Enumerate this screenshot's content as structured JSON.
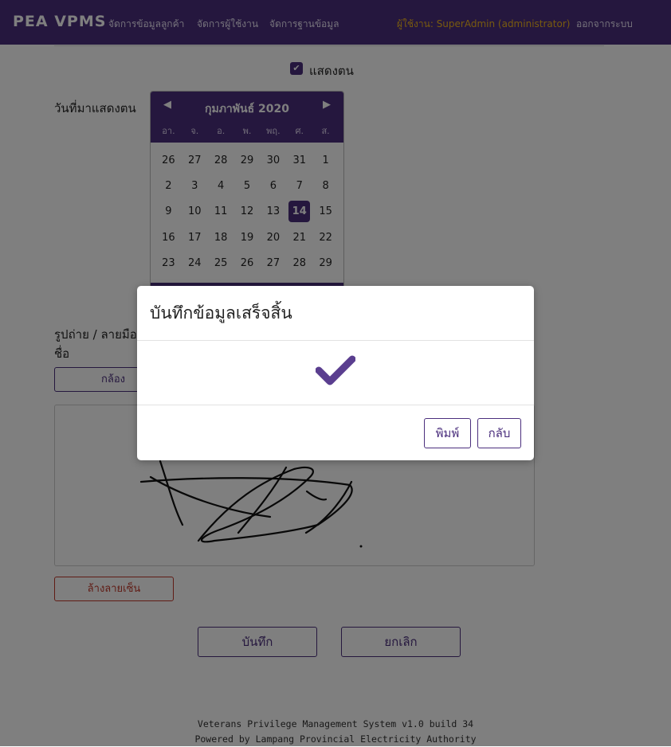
{
  "navbar": {
    "brand": "PEA VPMS",
    "menu": [
      "จัดการข้อมูลลูกค้า",
      "จัดการผู้ใช้งาน",
      "จัดการฐานข้อมูล"
    ],
    "user": "ผู้ใช้งาน: SuperAdmin (administrator)",
    "logout": "ออกจากระบบ",
    "colors": {
      "background": "#4b2f7d",
      "user_text": "#f0b41e"
    }
  },
  "form": {
    "show_checkbox_label": "แสดงตน",
    "show_checkbox_checked": true,
    "date_label": "วันที่มาแสดงตน",
    "photo_label": "รูปถ่าย / ลายมือชื่อ",
    "camera_button": "กล้อง",
    "clear_signature_button": "ล้างลายเซ็น",
    "save_button": "บันทึก",
    "cancel_button": "ยกเลิก"
  },
  "calendar": {
    "month_title": "กุมภาพันธ์ 2020",
    "prev_icon": "caret-left-icon",
    "next_icon": "caret-right-icon",
    "weekdays": [
      "อา.",
      "จ.",
      "อ.",
      "พ.",
      "พฤ.",
      "ศ.",
      "ส."
    ],
    "days": [
      "26",
      "27",
      "28",
      "29",
      "30",
      "31",
      "1",
      "2",
      "3",
      "4",
      "5",
      "6",
      "7",
      "8",
      "9",
      "10",
      "11",
      "12",
      "13",
      "14",
      "15",
      "16",
      "17",
      "18",
      "19",
      "20",
      "21",
      "22",
      "23",
      "24",
      "25",
      "26",
      "27",
      "28",
      "29"
    ],
    "selected_day": "14"
  },
  "modal": {
    "title": "บันทึกข้อมูลเสร็จสิ้น",
    "icon": "checkmark-icon",
    "print_button": "พิมพ์",
    "back_button": "กลับ"
  },
  "footer": {
    "line1": "Veterans Privilege Management System v1.0 build 34",
    "line2": "Powered by Lampang Provincial Electricity Authority"
  }
}
